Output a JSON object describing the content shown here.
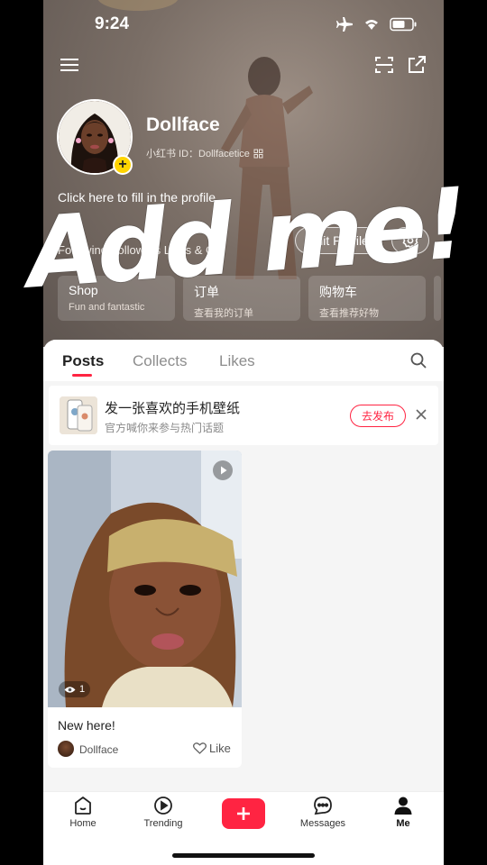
{
  "status_bar": {
    "time": "9:24"
  },
  "profile": {
    "name": "Dollface",
    "uid": "小红书 ID：Dollfacetice",
    "bio": "Click here to fill in the profile",
    "stats_text": "Following  Followers  Likes & Col",
    "edit_profile_label": "Edit Profile"
  },
  "feature_cards": [
    {
      "title": "Shop",
      "subtitle": "Fun and fantastic"
    },
    {
      "title": "订单",
      "subtitle": "查看我的订单"
    },
    {
      "title": "购物车",
      "subtitle": "查看推荐好物"
    }
  ],
  "overlay_text": "Add me!",
  "tabs": [
    {
      "label": "Posts"
    },
    {
      "label": "Collects"
    },
    {
      "label": "Likes"
    }
  ],
  "banner": {
    "title": "发一张喜欢的手机壁纸",
    "subtitle": "官方喊你来参与热门话题",
    "button": "去发布"
  },
  "post": {
    "title": "New here!",
    "author": "Dollface",
    "views": "1",
    "like_label": "Like"
  },
  "nav": [
    {
      "label": "Home"
    },
    {
      "label": "Trending"
    },
    {
      "label": ""
    },
    {
      "label": "Messages"
    },
    {
      "label": "Me"
    }
  ],
  "colors": {
    "accent": "#ff2442",
    "badge": "#ffd400"
  }
}
